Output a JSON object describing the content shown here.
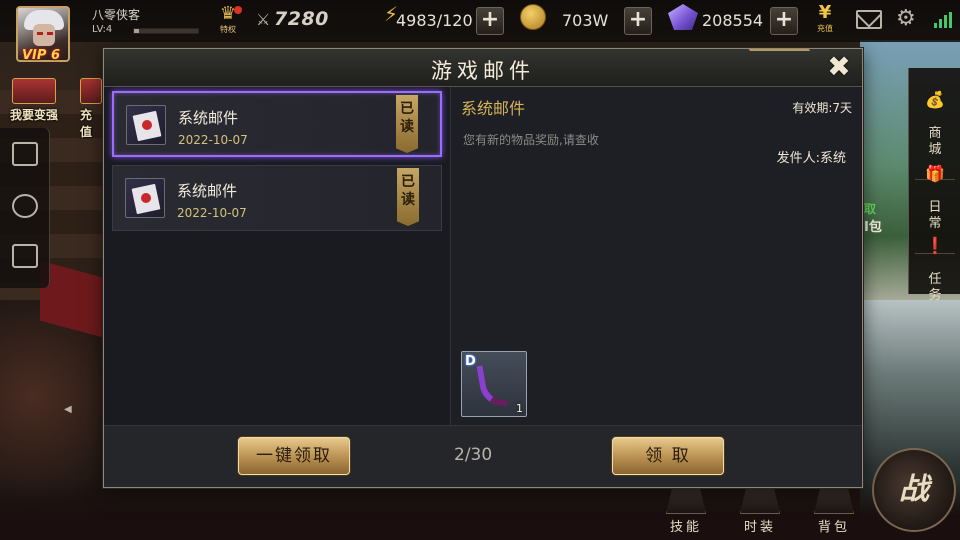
{
  "player": {
    "name": "八零侠客",
    "level": "LV:4",
    "vip": "VIP 6",
    "xp_fraction": 0.08
  },
  "hud": {
    "privilege_label": "特权",
    "power": "7280",
    "stamina": "4983/120",
    "gold": "703W",
    "diamonds": "208554",
    "recharge_label": "充值",
    "plus_label": "+"
  },
  "left_hud": {
    "strengthen_label": "我要变强",
    "recharge_short": "充值"
  },
  "right_hud": {
    "shop_label": "商\n城",
    "daily_label": "日\n常",
    "task_label": "任\n务",
    "behind_text_1": "取",
    "behind_text_2": "I包"
  },
  "bottom_hud": {
    "skills_label": "技能",
    "fashion_label": "时装",
    "bag_label": "背包",
    "battle_label": "战"
  },
  "dialog": {
    "title": "游戏邮件",
    "close_label": "✖",
    "mails": [
      {
        "subject": "系统邮件",
        "date": "2022-10-07",
        "read_label": "已\n读"
      },
      {
        "subject": "系统邮件",
        "date": "2022-10-07",
        "read_label": "已\n读"
      }
    ],
    "content": {
      "subject": "系统邮件",
      "expiry": "有效期:7天",
      "body": "您有新的物品奖励,请查收",
      "sender": "发件人:系统"
    },
    "attachment": {
      "grade": "D",
      "quantity": "1"
    },
    "footer": {
      "claim_all_label": "一键领取",
      "page": "2/30",
      "claim_label": "领 取"
    }
  },
  "colors": {
    "accent_purple": "#9a6cff",
    "gold": "#d6b45a",
    "date_yellow": "#d4c27a",
    "signal_green": "#46c76a"
  }
}
